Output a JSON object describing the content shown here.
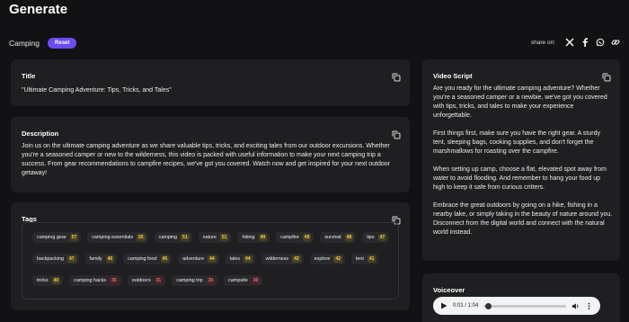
{
  "page": {
    "title": "Generate"
  },
  "topic": {
    "label": "Camping",
    "reset_label": "Reset"
  },
  "share": {
    "label": "share on:",
    "icons": [
      "x-icon",
      "facebook-icon",
      "whatsapp-icon",
      "link-icon"
    ]
  },
  "title_card": {
    "heading": "Title",
    "text": "\"Ultimate Camping Adventure: Tips, Tricks, and Tales\""
  },
  "description_card": {
    "heading": "Description",
    "text": "Join us on the ultimate camping adventure as we share valuable tips, tricks, and exciting tales from our outdoor excursions. Whether you're a seasoned camper or new to the wilderness, this video is packed with useful information to make your next camping trip a success. From gear recommendations to campfire recipes, we've got you covered. Watch now and get inspired for your next outdoor getaway!"
  },
  "tags_card": {
    "heading": "Tags",
    "rows": [
      [
        {
          "name": "camping gear",
          "count": "57",
          "color": "yellow"
        },
        {
          "name": "camping essentials",
          "count": "55",
          "color": "yellow"
        },
        {
          "name": "camping",
          "count": "51",
          "color": "yellow"
        },
        {
          "name": "nature",
          "count": "51",
          "color": "yellow"
        },
        {
          "name": "hiking",
          "count": "49",
          "color": "yellow"
        },
        {
          "name": "campfire",
          "count": "49",
          "color": "yellow"
        },
        {
          "name": "survival",
          "count": "48",
          "color": "yellow"
        },
        {
          "name": "tips",
          "count": "47",
          "color": "yellow"
        }
      ],
      [
        {
          "name": "backpacking",
          "count": "47",
          "color": "yellow"
        },
        {
          "name": "family",
          "count": "46",
          "color": "yellow"
        },
        {
          "name": "camping food",
          "count": "45",
          "color": "yellow"
        },
        {
          "name": "adventure",
          "count": "44",
          "color": "yellow"
        },
        {
          "name": "tales",
          "count": "44",
          "color": "yellow"
        },
        {
          "name": "wilderness",
          "count": "42",
          "color": "yellow"
        },
        {
          "name": "explore",
          "count": "42",
          "color": "yellow"
        },
        {
          "name": "tent",
          "count": "41",
          "color": "yellow"
        }
      ],
      [
        {
          "name": "tricks",
          "count": "40",
          "color": "yellow"
        },
        {
          "name": "camping hacks",
          "count": "35",
          "color": "red"
        },
        {
          "name": "outdoors",
          "count": "31",
          "color": "red"
        },
        {
          "name": "camping trip",
          "count": "30",
          "color": "red"
        },
        {
          "name": "campsite",
          "count": "30",
          "color": "red"
        }
      ]
    ]
  },
  "script_card": {
    "heading": "Video Script",
    "paragraphs": [
      "Are you ready for the ultimate camping adventure? Whether you're a seasoned camper or a newbie, we've got you covered with tips, tricks, and tales to make your experience unforgettable.",
      "First things first, make sure you have the right gear. A sturdy tent, sleeping bags, cooking supplies, and don't forget the marshmallows for roasting over the campfire.",
      "When setting up camp, choose a flat, elevated spot away from water to avoid flooding. And remember to hang your food up high to keep it safe from curious critters.",
      "Embrace the great outdoors by going on a hike, fishing in a nearby lake, or simply taking in the beauty of nature around you. Disconnect from the digital world and connect with the natural world instead."
    ]
  },
  "voiceover_card": {
    "heading": "Voiceover",
    "time": "0:01 / 1:04",
    "progress": 0.02
  },
  "colors": {
    "accent": "#6d4bf2",
    "background": "#121214",
    "card": "#1f1f22"
  }
}
